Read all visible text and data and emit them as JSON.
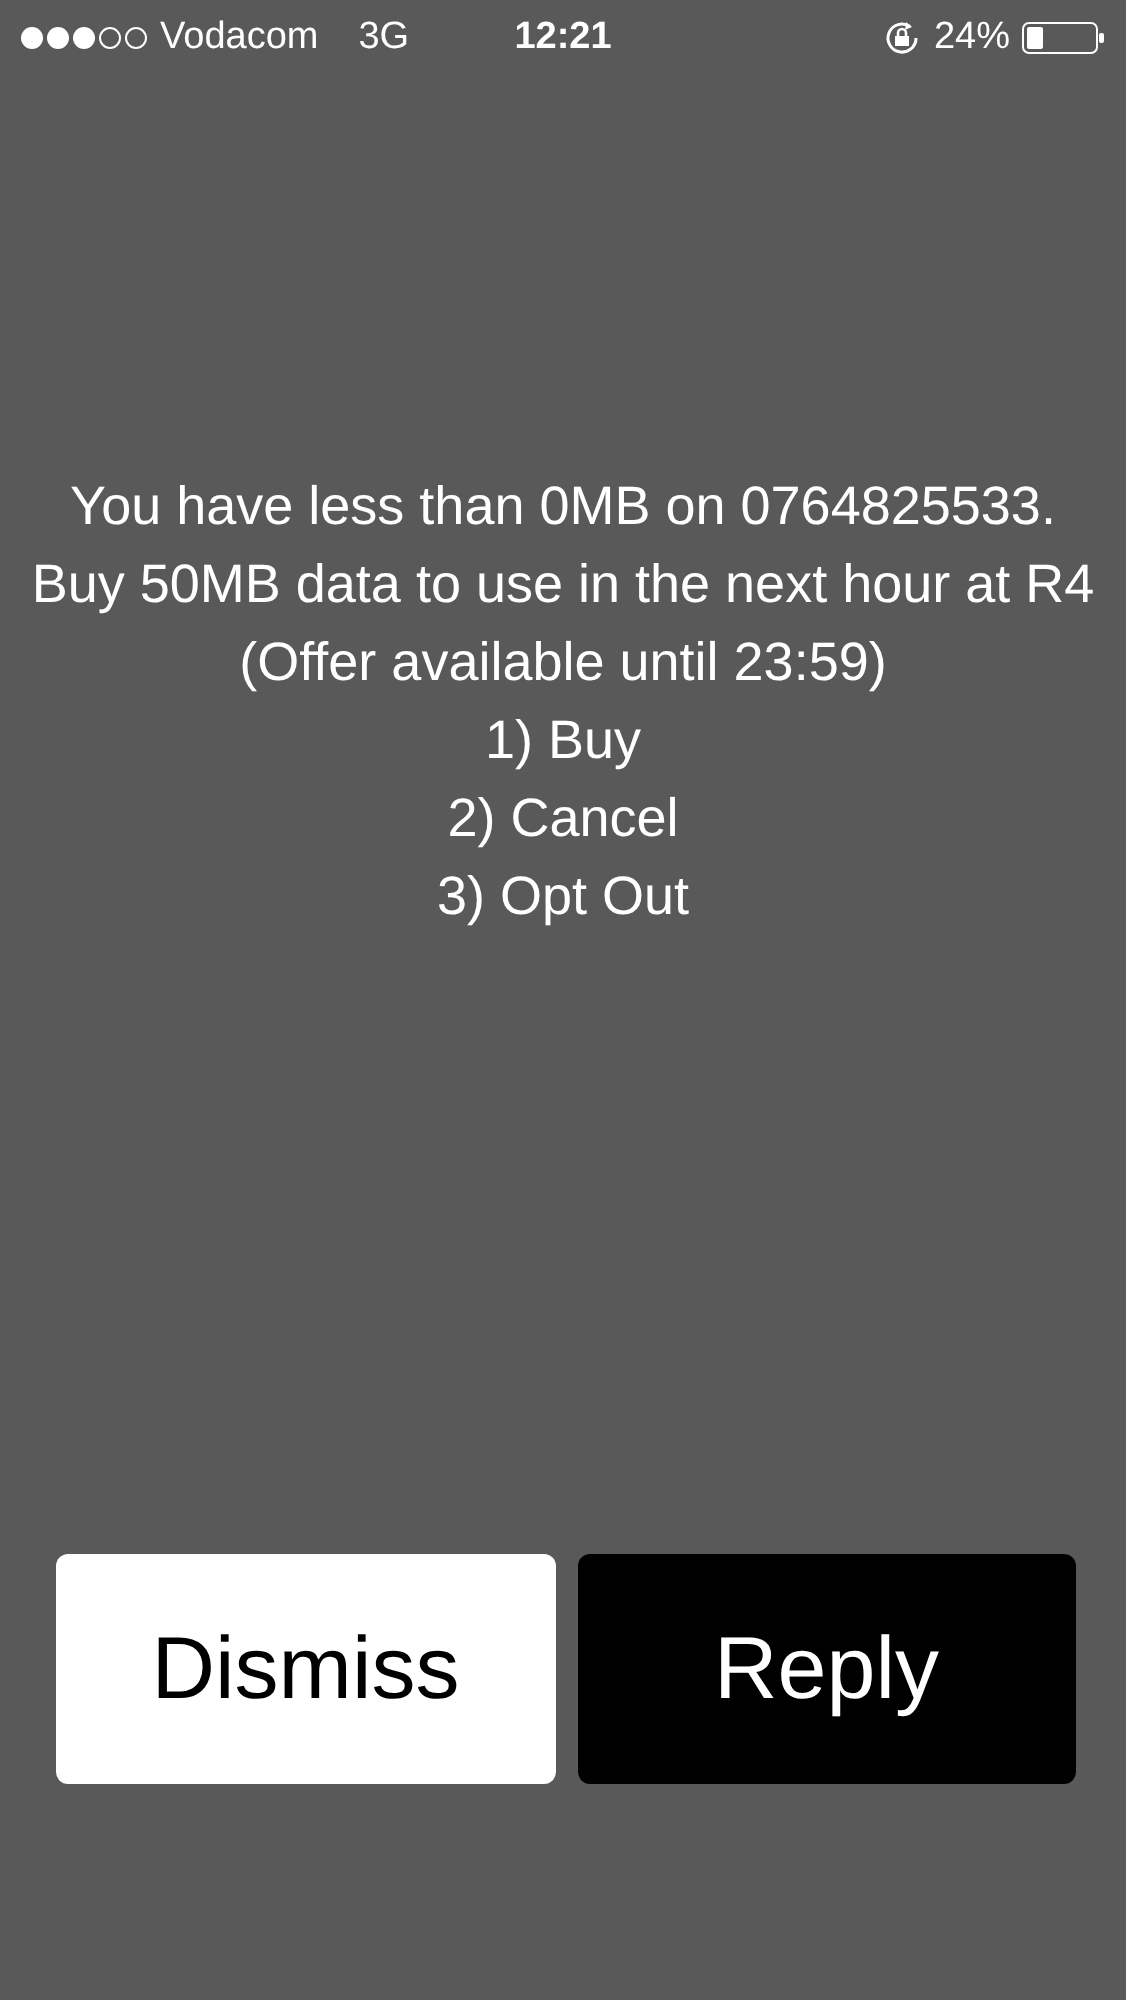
{
  "status_bar": {
    "carrier": "Vodacom",
    "network": "3G",
    "time": "12:21",
    "battery_text": "24%"
  },
  "message": {
    "lines": [
      "You have less than 0MB on 0764825533. Buy 50MB data to use in the next hour at R4 (Offer available until 23:59)",
      "1) Buy",
      "2) Cancel",
      "3) Opt Out"
    ]
  },
  "buttons": [
    {
      "label": "Dismiss",
      "kind": "light"
    },
    {
      "label": "Reply",
      "kind": "dark"
    }
  ]
}
